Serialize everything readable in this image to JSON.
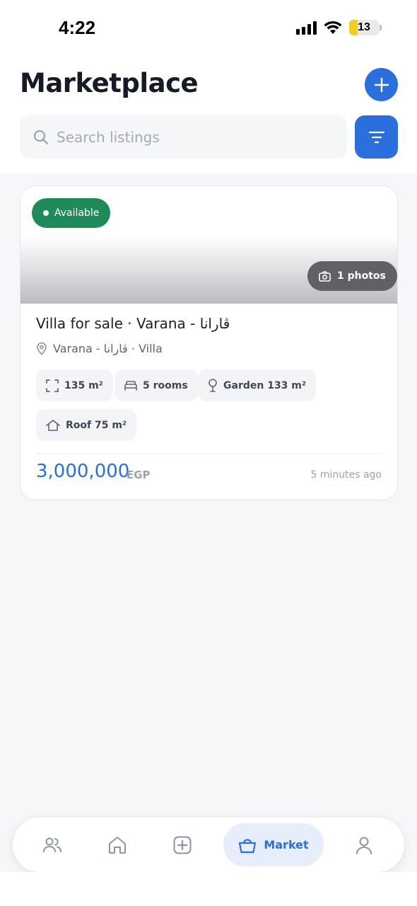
{
  "status_bar": {
    "time": "4:22",
    "battery": "13",
    "icons": [
      "signal-icon",
      "wifi-icon",
      "battery-icon"
    ]
  },
  "header": {
    "title": "Marketplace",
    "add_icon": "plus-icon",
    "search_placeholder": "Search listings",
    "search_value": "",
    "filter_icon": "filter-icon"
  },
  "listings": [
    {
      "status": "Available",
      "photos": "1 photos",
      "title": "Villa for sale · Varana - ڤارانا",
      "location": "Varana - ڤارانا · Villa",
      "features": [
        {
          "icon": "area-icon",
          "label": "135 m²"
        },
        {
          "icon": "bed-icon",
          "label": "5 rooms"
        },
        {
          "icon": "tree-icon",
          "label": "Garden 133 m²"
        },
        {
          "icon": "roof-icon",
          "label": "Roof 75 m²"
        }
      ],
      "price": "3,000,000",
      "currency": "EGP",
      "time_ago": "5 minutes ago"
    }
  ],
  "bottom_nav": {
    "items": [
      {
        "icon": "users-icon",
        "label": ""
      },
      {
        "icon": "home-icon",
        "label": ""
      },
      {
        "icon": "add-square-icon",
        "label": ""
      },
      {
        "icon": "basket-icon",
        "label": "Market",
        "active": true
      },
      {
        "icon": "profile-icon",
        "label": ""
      }
    ]
  },
  "colors": {
    "accent": "#2a6fdb",
    "available": "#1e8a5a",
    "background": "#f5f7fa"
  }
}
